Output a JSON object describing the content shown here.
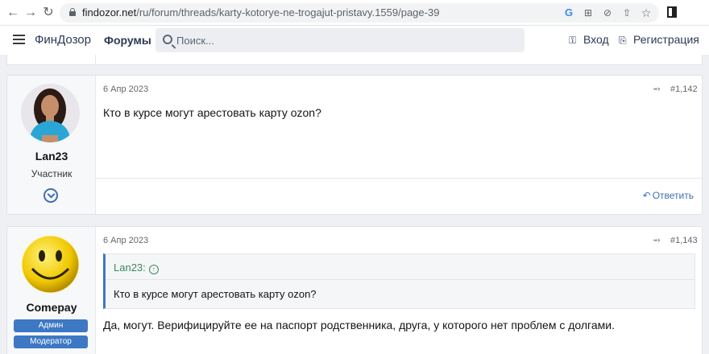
{
  "browser": {
    "url_host": "findozor.net",
    "url_path": "/ru/forum/threads/karty-kotorye-ne-trogajut-pristavy.1559/page-39"
  },
  "header": {
    "logo": "ФинДозор",
    "forums_label": "Форумы",
    "search_placeholder": "Поиск...",
    "login_label": "Вход",
    "register_label": "Регистрация"
  },
  "posts": [
    {
      "username": "Lan23",
      "user_title": "Участник",
      "date": "6 Апр 2023",
      "number": "#1,142",
      "text": "Кто в курсе могут арестовать карту ozon?",
      "reply_label": "Ответить"
    },
    {
      "username": "Comepay",
      "badges": [
        "Админ",
        "Модератор"
      ],
      "date": "6 Апр 2023",
      "number": "#1,143",
      "quote": {
        "author": "Lan23:",
        "text": "Кто в курсе могут арестовать карту ozon?"
      },
      "text": "Да, могут. Верифицируйте ее на паспорт родственника, друга, у которого нет проблем с долгами."
    }
  ],
  "colors": {
    "accent": "#3d78c4",
    "link": "#3f6fb3",
    "quote_author": "#3a8a5a",
    "page_bg": "#eef0f3"
  },
  "icons": {
    "back": "back-arrow-icon",
    "forward": "forward-arrow-icon",
    "reload": "reload-icon",
    "lock": "lock-icon",
    "menu": "hamburger-menu-icon",
    "search": "search-icon",
    "login": "key-icon",
    "register": "clipboard-icon",
    "share": "share-icon",
    "reply": "reply-icon",
    "expand": "chevron-down-circle-icon",
    "quote_jump": "arrow-up-circle-icon"
  }
}
